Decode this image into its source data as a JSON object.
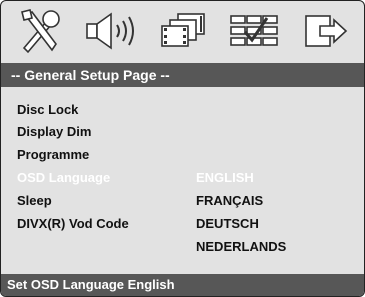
{
  "icons": [
    {
      "name": "tools-icon"
    },
    {
      "name": "speaker-icon"
    },
    {
      "name": "video-frames-icon"
    },
    {
      "name": "preferences-grid-icon"
    },
    {
      "name": "exit-icon"
    }
  ],
  "header": {
    "title": "--  General Setup Page  --"
  },
  "menu": {
    "items": [
      {
        "label": "Disc Lock"
      },
      {
        "label": "Display Dim"
      },
      {
        "label": "Programme"
      },
      {
        "label": "OSD Language"
      },
      {
        "label": "Sleep"
      },
      {
        "label": "DIVX(R) Vod Code"
      }
    ],
    "options": [
      {
        "label": "ENGLISH"
      },
      {
        "label": "FRANÇAIS"
      },
      {
        "label": "DEUTSCH"
      },
      {
        "label": "NEDERLANDS"
      }
    ]
  },
  "status": {
    "text": "Set OSD Language English"
  },
  "colors": {
    "bar": "#575757",
    "background": "#e2e2e2",
    "highlight_text": "#ffffff"
  }
}
